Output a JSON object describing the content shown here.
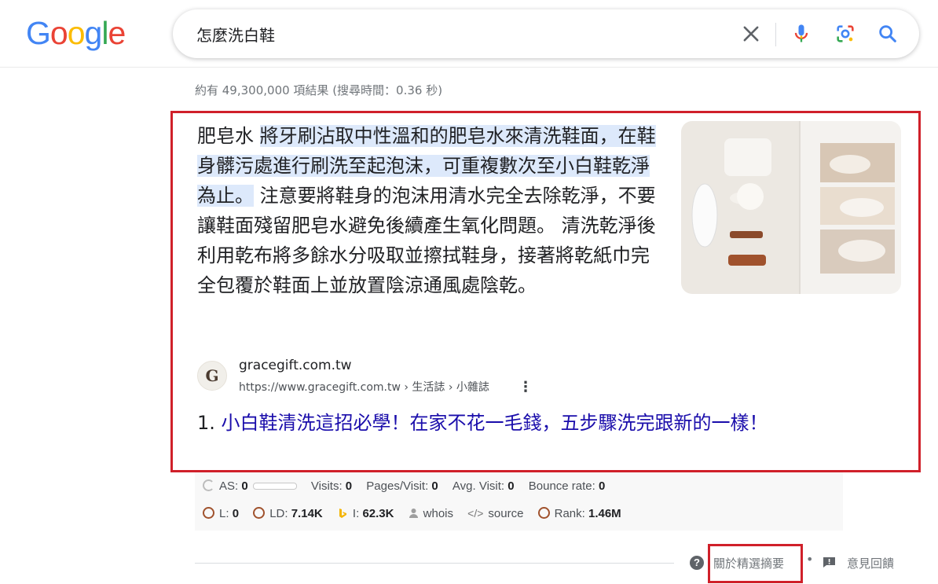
{
  "logo": {
    "letters": [
      "G",
      "o",
      "o",
      "g",
      "l",
      "e"
    ],
    "colors": [
      "#4285F4",
      "#EA4335",
      "#FBBC05",
      "#4285F4",
      "#34A853",
      "#EA4335"
    ]
  },
  "search": {
    "query": "怎麼洗白鞋"
  },
  "result_stats": "約有 49,300,000 項結果 (搜尋時間：0.36 秒)",
  "featured_snippet": {
    "lead": "肥皂水 ",
    "highlight": "將牙刷沾取中性溫和的肥皂水來清洗鞋面，在鞋身髒污處進行刷洗至起泡沫，可重複數次至小白鞋乾淨為止。",
    "rest": " 注意要將鞋身的泡沫用清水完全去除乾淨，不要讓鞋面殘留肥皂水避免後續產生氧化問題。 清洗乾淨後利用乾布將多餘水分吸取並擦拭鞋身，接著將乾紙巾完全包覆於鞋面上並放置陰涼通風處陰乾。",
    "source": {
      "favicon_letter": "G",
      "site": "gracegift.com.tw",
      "url": "https://www.gracegift.com.tw › 生活誌 › 小雜誌",
      "menu": "⋮"
    },
    "answer_number": "1.",
    "answer_title": "小白鞋清洗這招必學！在家不花一毛錢，五步驟洗完跟新的一樣！"
  },
  "seo_bar": {
    "row1": [
      {
        "label": "AS:",
        "value": "0"
      },
      {
        "label": "Visits:",
        "value": "0"
      },
      {
        "label": "Pages/Visit:",
        "value": "0"
      },
      {
        "label": "Avg. Visit:",
        "value": "0"
      },
      {
        "label": "Bounce rate:",
        "value": "0"
      }
    ],
    "row2": [
      {
        "label": "L:",
        "value": "0"
      },
      {
        "label": "LD:",
        "value": "7.14K"
      },
      {
        "label": "I:",
        "value": "62.3K"
      },
      {
        "label": "whois",
        "value": ""
      },
      {
        "label": "source",
        "value": ""
      },
      {
        "label": "Rank:",
        "value": "1.46M"
      }
    ]
  },
  "footer": {
    "about": "關於精選摘要",
    "separator": "•",
    "feedback": "意見回饋"
  },
  "colors": {
    "link": "#1a0dab",
    "highlight": "#dde9fb",
    "annotation": "#d0202a"
  }
}
